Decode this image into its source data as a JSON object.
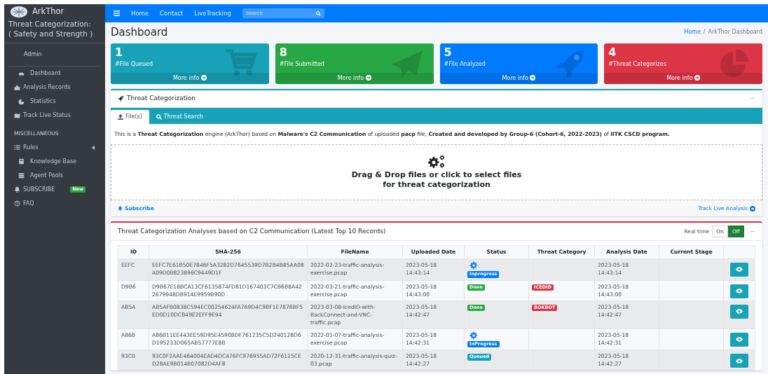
{
  "sidebar": {
    "brand": "ArkThor",
    "subtitle": "Threat Categorization:\n( Safety and Strength )",
    "user": "Admin",
    "items": [
      {
        "label": "Dashboard",
        "kind": "item"
      },
      {
        "label": "Analysis Records",
        "kind": "item"
      },
      {
        "label": "Statistics",
        "kind": "item"
      },
      {
        "label": "Track Live Status",
        "kind": "item"
      },
      {
        "label": "MISCELLANEOUS",
        "kind": "header"
      },
      {
        "label": "Rules",
        "kind": "item",
        "expanded": false
      },
      {
        "label": "Knowledge Base",
        "kind": "item"
      },
      {
        "label": "Agent Pools",
        "kind": "item"
      },
      {
        "label": "SUBSCRIBE",
        "kind": "item",
        "badge": "New"
      },
      {
        "label": "FAQ",
        "kind": "item"
      }
    ]
  },
  "navbar": {
    "links": [
      "Home",
      "Contact",
      "LiveTracking"
    ],
    "search": {
      "placeholder": "Search"
    }
  },
  "page": {
    "title": "Dashboard",
    "breadcrumb": [
      {
        "label": "Home",
        "kind": "link"
      },
      {
        "label": "/",
        "kind": "separator"
      },
      {
        "label": "ArkThor Dashboard",
        "kind": "current"
      }
    ]
  },
  "stats": [
    {
      "value": "1",
      "label": "#File Queued",
      "link": "More info",
      "color": "#17a2b8"
    },
    {
      "value": "8",
      "label": "#File Submitted",
      "link": "More info",
      "color": "#28a745"
    },
    {
      "value": "5",
      "label": "#File Analyzed",
      "link": "More info",
      "color": "#007bff"
    },
    {
      "value": "4",
      "label": "#Threat Categorizes",
      "link": "More info",
      "color": "#dc3545"
    }
  ],
  "upload_card": {
    "title": "Threat Categorization",
    "collapse": "—",
    "tabs": [
      {
        "label": "File(s)",
        "selected": true
      },
      {
        "label": "Threat Search",
        "selected": false
      }
    ],
    "description": "This is a **Threat Categorization** engine (ArkThor) based on **Malware's C2 Communication** of uploaded **pacp** file, **Created and developed by Group-6 (Cohort-6, 2022-2023)** of **IITK CSCD program.**",
    "dropzone": "Drag & Drop files or click to select files\nfor threat categorization",
    "footer_left": "Subscribe",
    "footer_right": "Track Live Analysis"
  },
  "table_card": {
    "title": "Threat Categorization Analyses based on C2 Communication (Latest Top 10 Records)",
    "collapse": "—",
    "realtime": {
      "label": "Real time",
      "options": [
        {
          "label": "On",
          "selected": false
        },
        {
          "label": "Off",
          "selected": true
        }
      ]
    },
    "columns": [
      "ID",
      "SHA-256",
      "FileName",
      "Uploaded Date",
      "Status",
      "Threat Category",
      "Analysis Date",
      "Current Stage"
    ],
    "rows": [
      {
        "id": "EEFC",
        "sha": "EEFC7E61B50E7846F5A3282D7645539D7B2B4B85AA08A09D0B823896C9449D1F",
        "file": "2022-02-23-traffic-analysis-exercise.pcap",
        "uploaded": "2023-05-18\n14:43:14",
        "status": {
          "label": "Inprogress",
          "kind": "inprogress"
        },
        "analysis": "2023-05-18\n14:43:14"
      },
      {
        "id": "D9B6",
        "sha": "D9B67E18BCA13CF6135874FD81D167403C7CB6B8A422679948DB914E9959B90D",
        "file": "2022-03-21-traffic-analysis-exercise.pcap",
        "uploaded": "2023-05-18\n14:43:00",
        "status": {
          "label": "Done",
          "kind": "done"
        },
        "category": "ICEDID",
        "analysis": "2023-05-18\n14:43:00"
      },
      {
        "id": "AB5A",
        "sha": "AB5AFB0838C594EC00254624FA769D4C9BF1E7876BF5ED0D10DCB49E2EFF9E94",
        "file": "2023-03-08-IcedID-with-BackConnect-and-VNC-traffic.pcap",
        "uploaded": "2023-05-18\n14:42:47",
        "status": {
          "label": "Done",
          "kind": "done"
        },
        "category": "BOKBOT",
        "analysis": "2023-05-18\n14:42:47"
      },
      {
        "id": "A86B",
        "sha": "A86B11EE443EE59D95E4590BDF761235C5D240128D6D195233D065AB57777E8B",
        "file": "2022-01-07-traffic-analysis-exercise.pcap",
        "uploaded": "2023-05-18\n14:42:31",
        "status": {
          "label": "InProgress",
          "kind": "inprogress"
        },
        "analysis": "2023-05-18\n14:42:31"
      },
      {
        "id": "93C0",
        "sha": "93C0F2AAE464004EAD4DC476FC976955AD72F6115CED28AE9B014B07082D4AF8",
        "file": "2020-12-31-traffic-analysis-quiz-03.pcap",
        "uploaded": "2023-05-18\n14:42:27",
        "status": {
          "label": "Queued",
          "kind": "queued"
        },
        "analysis": "2023-05-18\n14:42:27"
      }
    ]
  }
}
